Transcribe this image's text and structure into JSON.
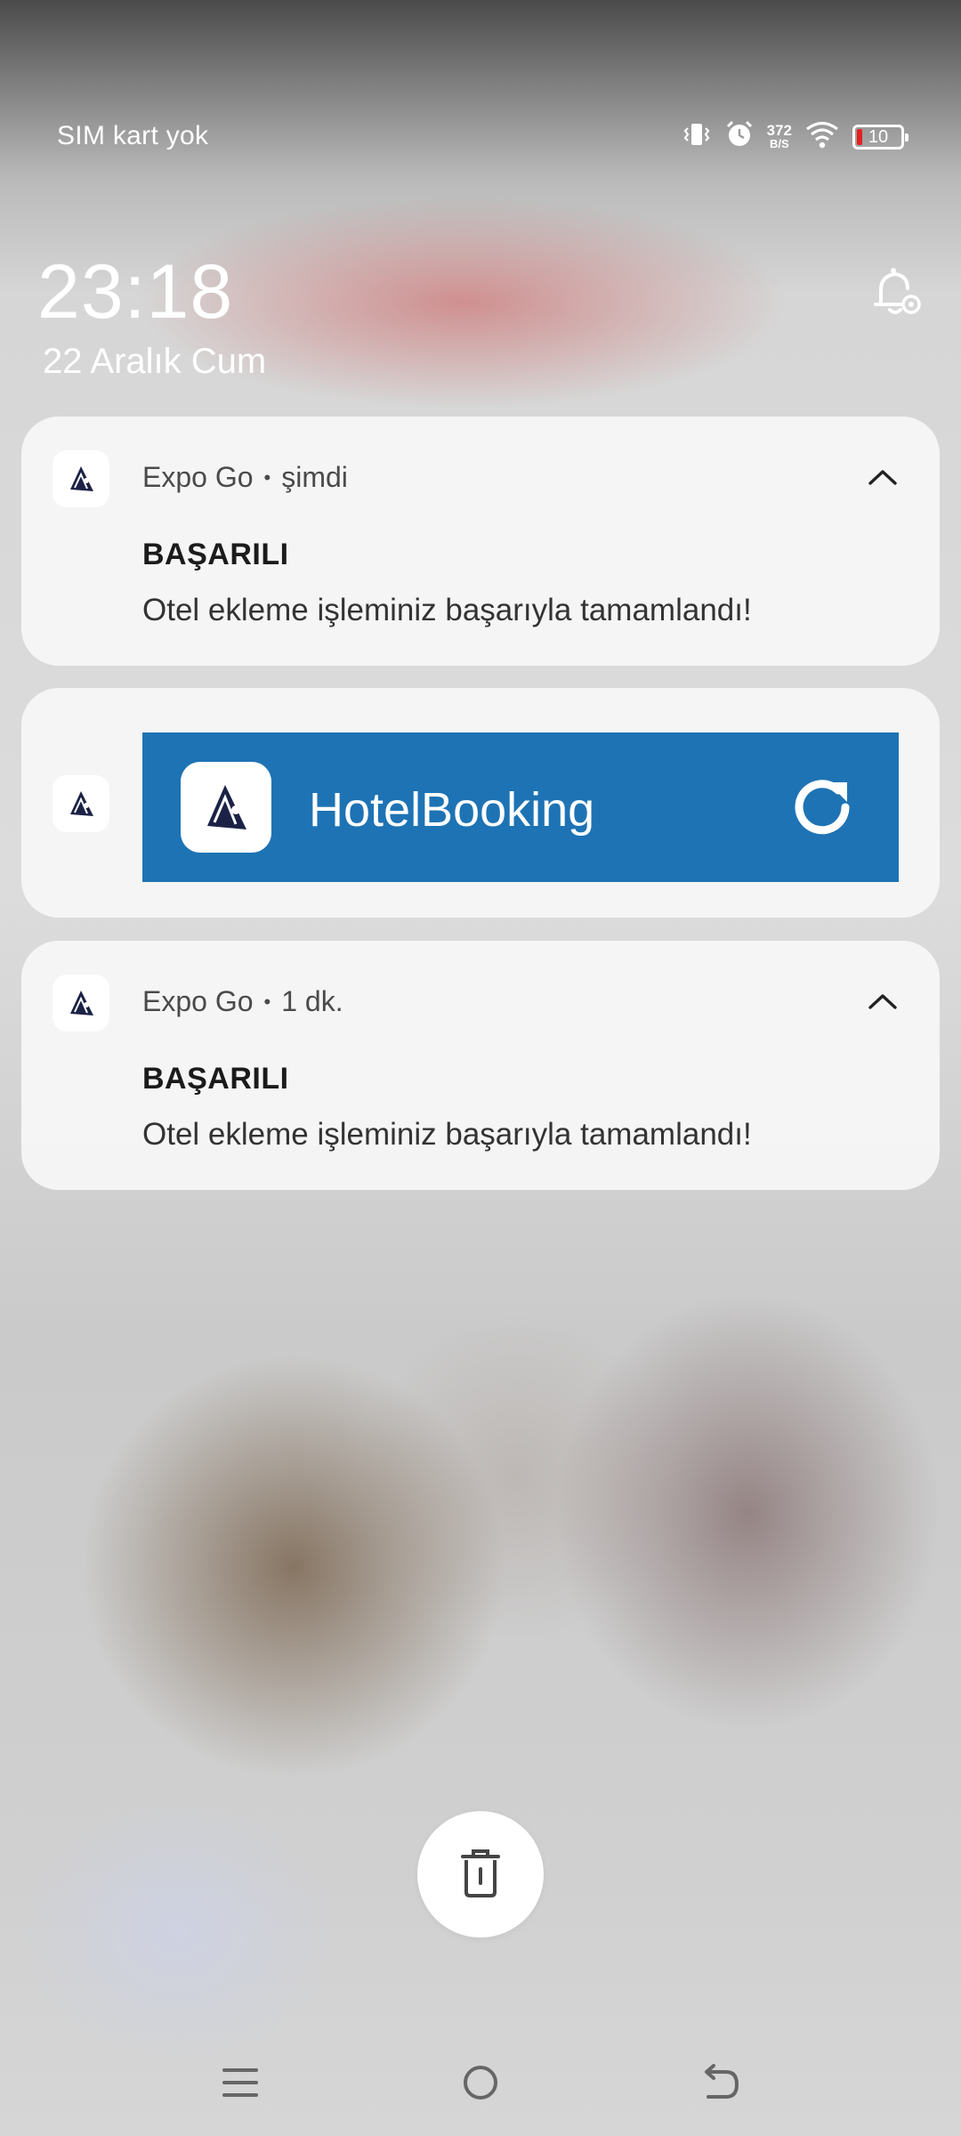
{
  "status_bar": {
    "carrier": "SIM kart yok",
    "net_speed_value": "372",
    "net_speed_unit": "B/S",
    "battery_level": "10",
    "battery_color": "#e52020",
    "icons": [
      "vibrate-icon",
      "alarm-icon",
      "wifi-icon",
      "battery-icon"
    ]
  },
  "lockscreen": {
    "time": "23:18",
    "date": "22 Aralık Cum"
  },
  "notifications": [
    {
      "app": "Expo Go",
      "time": "şimdi",
      "title": "BAŞARILI",
      "body": "Otel ekleme işleminiz başarıyla tamamlandı!"
    },
    {
      "app_banner_title": "HotelBooking",
      "banner_color": "#1e73b4"
    },
    {
      "app": "Expo Go",
      "time": "1 dk.",
      "title": "BAŞARILI",
      "body": "Otel ekleme işleminiz başarıyla tamamlandı!"
    }
  ],
  "actions": {
    "clear_icon": "trash-icon"
  },
  "navbar": {
    "icons": [
      "menu-icon",
      "home-icon",
      "back-icon"
    ]
  }
}
